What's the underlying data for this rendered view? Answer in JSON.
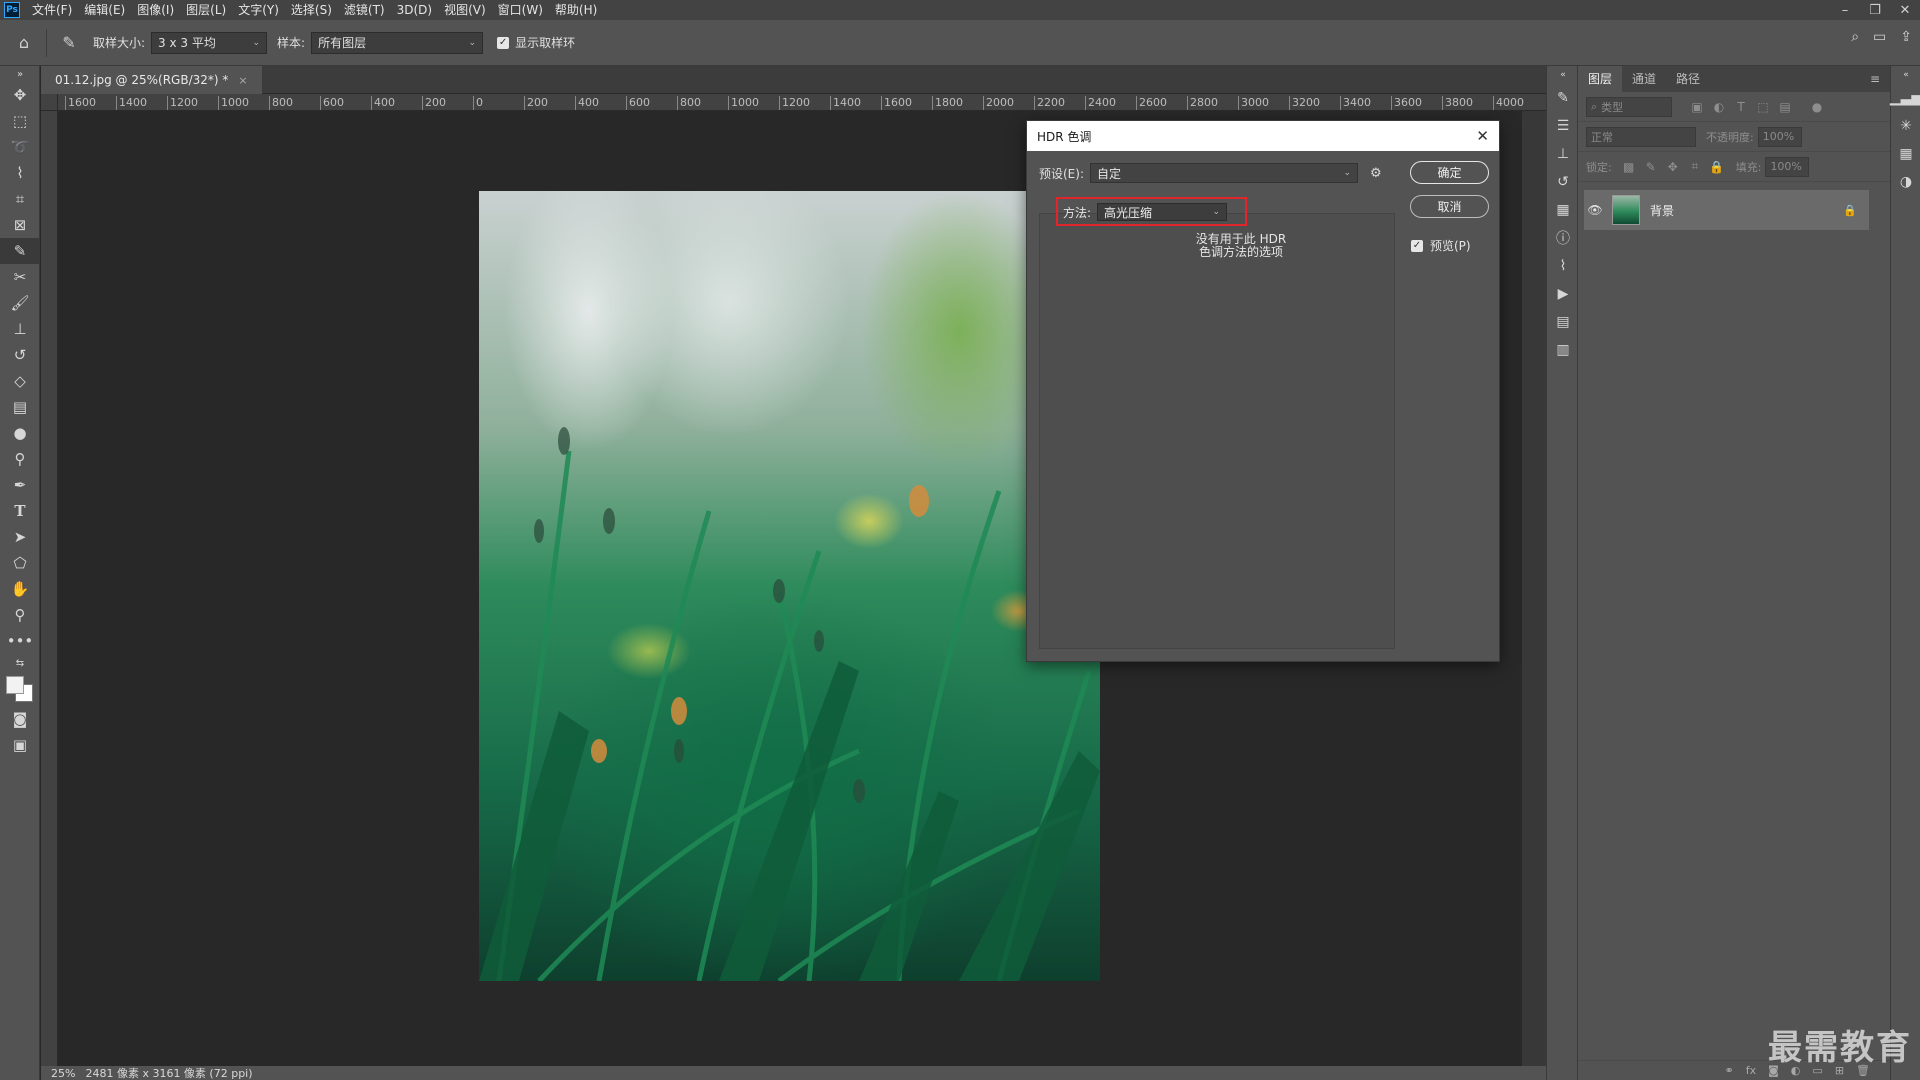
{
  "app": {
    "logo": "Ps"
  },
  "menu": [
    "文件(F)",
    "编辑(E)",
    "图像(I)",
    "图层(L)",
    "文字(Y)",
    "选择(S)",
    "滤镜(T)",
    "3D(D)",
    "视图(V)",
    "窗口(W)",
    "帮助(H)"
  ],
  "window_controls": {
    "minimize": "–",
    "restore": "❐",
    "close": "✕"
  },
  "options_bar": {
    "sample_size_label": "取样大小:",
    "sample_size_value": "3 x 3 平均",
    "sample_label": "样本:",
    "sample_value": "所有图层",
    "show_ring_label": "显示取样环",
    "show_ring_checked": true
  },
  "document": {
    "tab_title": "01.12.jpg @ 25%(RGB/32*) *",
    "close": "×"
  },
  "ruler_ticks": [
    "1600",
    "1400",
    "1200",
    "1000",
    "800",
    "600",
    "400",
    "200",
    "0",
    "200",
    "400",
    "600",
    "800",
    "1000",
    "1200",
    "1400",
    "1600",
    "1800",
    "2000",
    "2200",
    "2400",
    "2600",
    "2800",
    "3000",
    "3200",
    "3400",
    "3600",
    "3800",
    "4000"
  ],
  "status": {
    "zoom": "25%",
    "dimensions": "2481 像素 x 3161 像素 (72 ppi)"
  },
  "layers_panel": {
    "tabs": [
      "图层",
      "通道",
      "路径"
    ],
    "active_tab": 0,
    "filter_placeholder": "类型",
    "blend_mode": "正常",
    "opacity_label": "不透明度:",
    "opacity_value": "100%",
    "lock_label": "锁定:",
    "fill_label": "填充:",
    "fill_value": "100%",
    "layers": [
      {
        "name": "背景",
        "visible": true,
        "locked": true
      }
    ]
  },
  "hdr_dialog": {
    "title": "HDR 色调",
    "close": "✕",
    "preset_label": "预设(E):",
    "preset_value": "自定",
    "method_label": "方法:",
    "method_value": "高光压缩",
    "no_options_line1": "没有用于此 HDR",
    "no_options_line2": "色调方法的选项",
    "ok_label": "确定",
    "cancel_label": "取消",
    "preview_label": "预览(P)",
    "preview_checked": true,
    "highlight_color": "#e0252b"
  },
  "watermark": "最需教育"
}
